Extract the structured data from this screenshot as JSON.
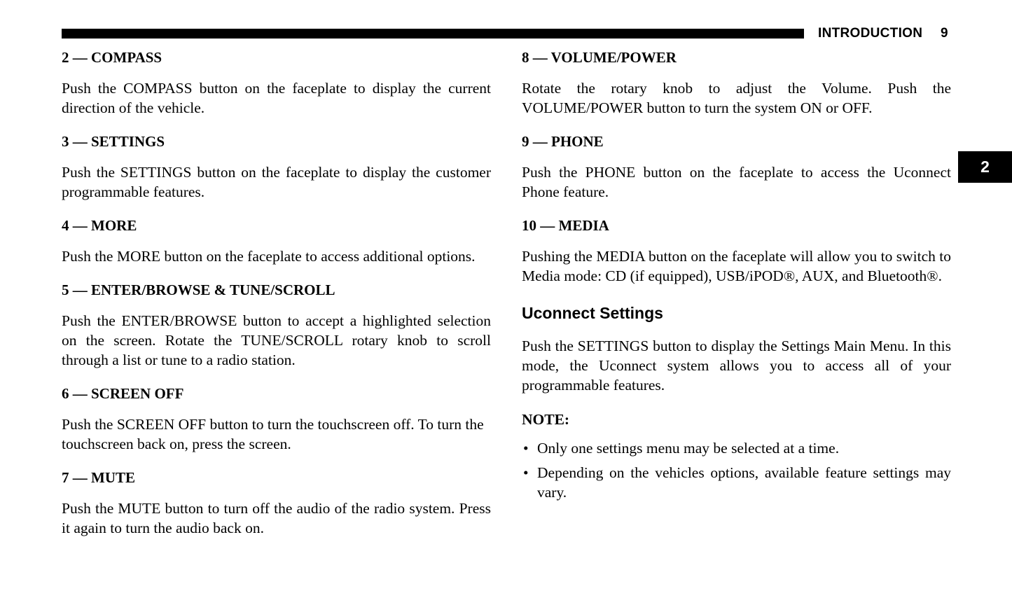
{
  "header": {
    "title": "INTRODUCTION",
    "page_number": "9",
    "rule_color": "#000000"
  },
  "section_tab": {
    "label": "2",
    "background": "#000000",
    "text_color": "#ffffff"
  },
  "left_column": {
    "sections": [
      {
        "heading": "2 — COMPASS",
        "body": "Push the COMPASS button on the faceplate to display the current direction of the vehicle."
      },
      {
        "heading": "3 — SETTINGS",
        "body": "Push the SETTINGS button on the faceplate to display the customer programmable features."
      },
      {
        "heading": "4 — MORE",
        "body": "Push the MORE button on the faceplate to access additional options."
      },
      {
        "heading": "5 — ENTER/BROWSE & TUNE/SCROLL",
        "body": "Push the ENTER/BROWSE button to accept a highlighted selection on the screen. Rotate the TUNE/SCROLL rotary knob to scroll through a list or tune to a radio station."
      },
      {
        "heading": "6 — SCREEN OFF",
        "body": "Push the SCREEN OFF button to turn the touchscreen off. To turn the touchscreen back on, press the screen."
      },
      {
        "heading": "7 — MUTE",
        "body": "Push the MUTE button to turn off the audio of the radio system. Press it again to turn the audio back on."
      }
    ]
  },
  "right_column": {
    "sections": [
      {
        "heading": "8 — VOLUME/POWER",
        "body": "Rotate the rotary knob to adjust the Volume. Push the VOLUME/POWER button to turn the system ON or OFF."
      },
      {
        "heading": "9 — PHONE",
        "body": "Push the PHONE button on the faceplate to access the Uconnect Phone feature."
      },
      {
        "heading": "10 — MEDIA",
        "body": "Pushing the MEDIA button on the faceplate will allow you to switch to Media mode: CD (if equipped), USB/iPOD®, AUX, and Bluetooth®."
      }
    ],
    "subsection": {
      "heading": "Uconnect Settings",
      "body": "Push the SETTINGS button to display the Settings Main Menu. In this mode, the Uconnect system allows you to access all of your programmable features.",
      "note_label": "NOTE:",
      "note_items": [
        "Only one settings menu may be selected at a time.",
        "Depending on the vehicles options, available feature settings may vary."
      ],
      "bullet_glyph": "•"
    }
  }
}
